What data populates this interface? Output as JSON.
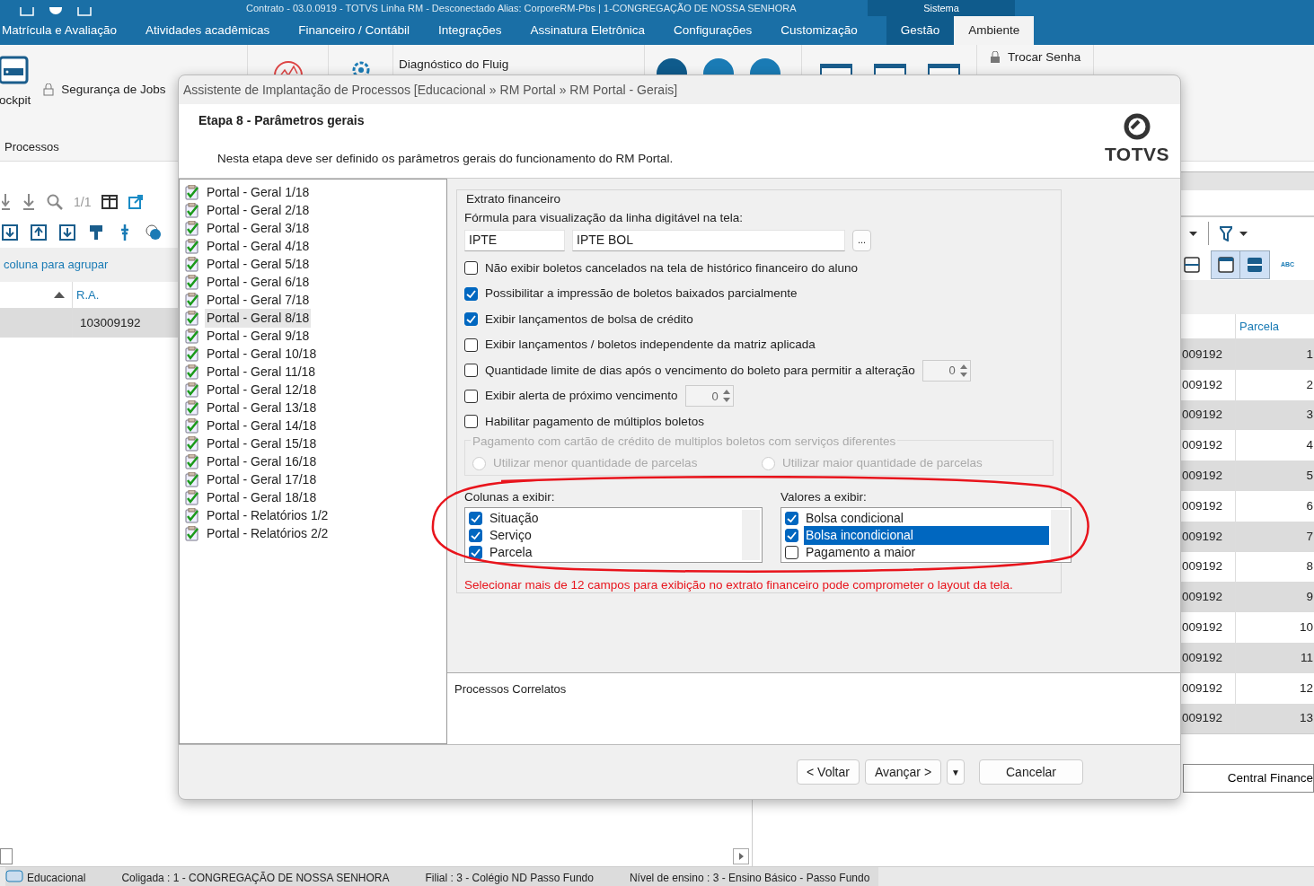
{
  "app_title": "Contrato - 03.0.0919 - TOTVS Linha RM - Desconectado  Alias: CorporeRM-Pbs | 1-CONGREGAÇÃO DE NOSSA SENHORA",
  "context_label": "Sistema",
  "menu_tabs": [
    {
      "label": "Matrícula e Avaliação",
      "selected": false,
      "contextual": false
    },
    {
      "label": "Atividades acadêmicas",
      "selected": false,
      "contextual": false
    },
    {
      "label": "Financeiro / Contábil",
      "selected": false,
      "contextual": false
    },
    {
      "label": "Integrações",
      "selected": false,
      "contextual": false
    },
    {
      "label": "Assinatura Eletrônica",
      "selected": false,
      "contextual": false
    },
    {
      "label": "Configurações",
      "selected": false,
      "contextual": false
    },
    {
      "label": "Customização",
      "selected": false,
      "contextual": false
    },
    {
      "label": "Gestão",
      "selected": false,
      "contextual": true
    },
    {
      "label": "Ambiente",
      "selected": true,
      "contextual": true
    }
  ],
  "ribbon": {
    "cockpit": "ockpit",
    "jobs": "Segurança de Jobs",
    "fluig": "Diagnóstico do Fluig",
    "password": "Trocar Senha",
    "group_label": "Processos"
  },
  "left_grid": {
    "pager": "1/1",
    "group_hint": "coluna para agrupar",
    "column": "R.A.",
    "rows": [
      {
        "value": "103009192",
        "selected": true
      }
    ]
  },
  "right_grid": {
    "abc": "ABC",
    "column": "Parcela",
    "rows": [
      {
        "ra": "009192",
        "parcela": "1"
      },
      {
        "ra": "009192",
        "parcela": "2"
      },
      {
        "ra": "009192",
        "parcela": "3"
      },
      {
        "ra": "009192",
        "parcela": "4"
      },
      {
        "ra": "009192",
        "parcela": "5"
      },
      {
        "ra": "009192",
        "parcela": "6"
      },
      {
        "ra": "009192",
        "parcela": "7"
      },
      {
        "ra": "009192",
        "parcela": "8"
      },
      {
        "ra": "009192",
        "parcela": "9"
      },
      {
        "ra": "009192",
        "parcela": "10"
      },
      {
        "ra": "009192",
        "parcela": "11"
      },
      {
        "ra": "009192",
        "parcela": "12"
      },
      {
        "ra": "009192",
        "parcela": "13"
      }
    ],
    "button": "Central Finance"
  },
  "dialog": {
    "title": "Assistente de Implantação de Processos [Educacional » RM Portal » RM Portal - Gerais]",
    "step_title": "Etapa 8 - Parâmetros gerais",
    "description": "Nesta etapa deve ser definido os parâmetros gerais do funcionamento do RM Portal.",
    "logo": "TOTVS",
    "steps": [
      {
        "label": "Portal - Geral 1/18",
        "selected": false
      },
      {
        "label": "Portal - Geral 2/18",
        "selected": false
      },
      {
        "label": "Portal - Geral 3/18",
        "selected": false
      },
      {
        "label": "Portal - Geral 4/18",
        "selected": false
      },
      {
        "label": "Portal - Geral 5/18",
        "selected": false
      },
      {
        "label": "Portal - Geral 6/18",
        "selected": false
      },
      {
        "label": "Portal - Geral 7/18",
        "selected": false
      },
      {
        "label": "Portal - Geral 8/18",
        "selected": true
      },
      {
        "label": "Portal - Geral 9/18",
        "selected": false
      },
      {
        "label": "Portal - Geral 10/18",
        "selected": false
      },
      {
        "label": "Portal - Geral 11/18",
        "selected": false
      },
      {
        "label": "Portal - Geral 12/18",
        "selected": false
      },
      {
        "label": "Portal - Geral 13/18",
        "selected": false
      },
      {
        "label": "Portal - Geral 14/18",
        "selected": false
      },
      {
        "label": "Portal - Geral 15/18",
        "selected": false
      },
      {
        "label": "Portal - Geral 16/18",
        "selected": false
      },
      {
        "label": "Portal - Geral 17/18",
        "selected": false
      },
      {
        "label": "Portal - Geral 18/18",
        "selected": false
      },
      {
        "label": "Portal - Relatórios 1/2",
        "selected": false
      },
      {
        "label": "Portal - Relatórios 2/2",
        "selected": false
      }
    ],
    "group_title": "Extrato financeiro",
    "formula_label": "Fórmula para visualização da linha digitável na tela:",
    "formula_code": "IPTE",
    "formula_name": "IPTE BOL",
    "browse": "...",
    "options": [
      {
        "kind": "checkbox",
        "label": "Não exibir boletos cancelados na tela de histórico financeiro do aluno",
        "checked": false
      },
      {
        "kind": "checkbox",
        "label": "Possibilitar a impressão de boletos baixados parcialmente",
        "checked": true
      },
      {
        "kind": "checkbox",
        "label": "Exibir lançamentos de bolsa de crédito",
        "checked": true
      },
      {
        "kind": "checkbox",
        "label": "Exibir lançamentos / boletos independente da matriz aplicada",
        "checked": false
      },
      {
        "kind": "spin",
        "label": "Quantidade limite de dias após o vencimento do boleto para permitir a alteração",
        "checked": false,
        "value": "0"
      },
      {
        "kind": "spin",
        "label": "Exibir alerta de próximo vencimento",
        "checked": false,
        "value": "0"
      },
      {
        "kind": "checkbox",
        "label": "Habilitar pagamento de múltiplos boletos",
        "checked": false
      }
    ],
    "card_group": {
      "title": "Pagamento com cartão de crédito de multiplos boletos com serviços diferentes",
      "disabled": true,
      "radios": [
        {
          "label": "Utilizar menor quantidade de parcelas",
          "selected": false
        },
        {
          "label": "Utilizar maior quantidade de parcelas",
          "selected": false
        }
      ]
    },
    "columns_list": {
      "label": "Colunas a exibir:",
      "items": [
        {
          "label": "Situação",
          "checked": true,
          "selected": false
        },
        {
          "label": "Serviço",
          "checked": true,
          "selected": false
        },
        {
          "label": "Parcela",
          "checked": true,
          "selected": false
        }
      ]
    },
    "values_list": {
      "label": "Valores a exibir:",
      "items": [
        {
          "label": "Bolsa condicional",
          "checked": true,
          "selected": false
        },
        {
          "label": "Bolsa incondicional",
          "checked": true,
          "selected": true
        },
        {
          "label": "Pagamento a maior",
          "checked": false,
          "selected": false
        }
      ]
    },
    "warning": "Selecionar mais de 12 campos para exibição no extrato financeiro pode comprometer o layout da tela.",
    "related_label": "Processos Correlatos",
    "buttons": [
      {
        "kind": "button",
        "label": "< Voltar"
      },
      {
        "kind": "button",
        "label": "Avançar >"
      },
      {
        "kind": "dropdown",
        "label": "▼"
      },
      {
        "kind": "spacer-button",
        "label": "Cancelar"
      }
    ]
  },
  "status_bar": [
    {
      "label": "Educacional",
      "icon": true
    },
    {
      "label": "Coligada : 1 - CONGREGAÇÃO DE NOSSA SENHORA",
      "icon": false
    },
    {
      "label": "Filial : 3 - Colégio ND Passo Fundo",
      "icon": false
    },
    {
      "label": "Nível de ensino : 3 - Ensino Básico - Passo Fundo",
      "icon": false
    }
  ]
}
